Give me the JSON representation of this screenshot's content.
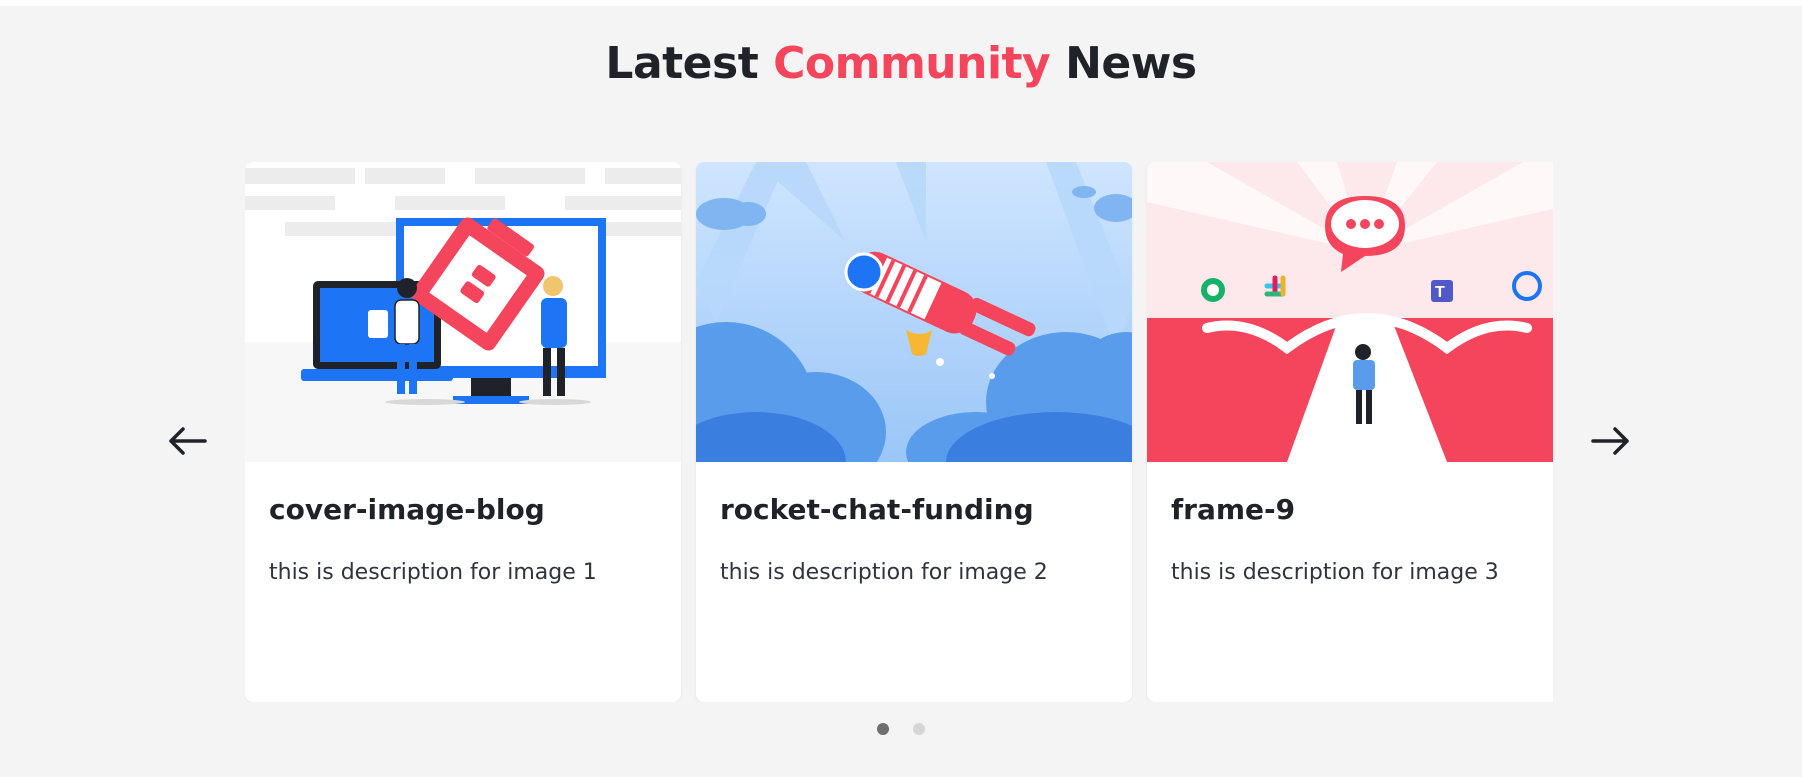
{
  "section": {
    "title_part1": "Latest ",
    "title_accent": "Community",
    "title_part2": " News"
  },
  "carousel": {
    "prev_icon": "arrow-left-icon",
    "next_icon": "arrow-right-icon",
    "cards": [
      {
        "title": "cover-image-blog",
        "description": "this is description for image 1"
      },
      {
        "title": "rocket-chat-funding",
        "description": "this is description for image 2"
      },
      {
        "title": "frame-9",
        "description": "this is description for image 3"
      }
    ],
    "page_count": 2,
    "active_page": 1
  },
  "colors": {
    "accent": "#f5455c",
    "background": "#f4f4f4",
    "brand_blue": "#1d74f5"
  }
}
